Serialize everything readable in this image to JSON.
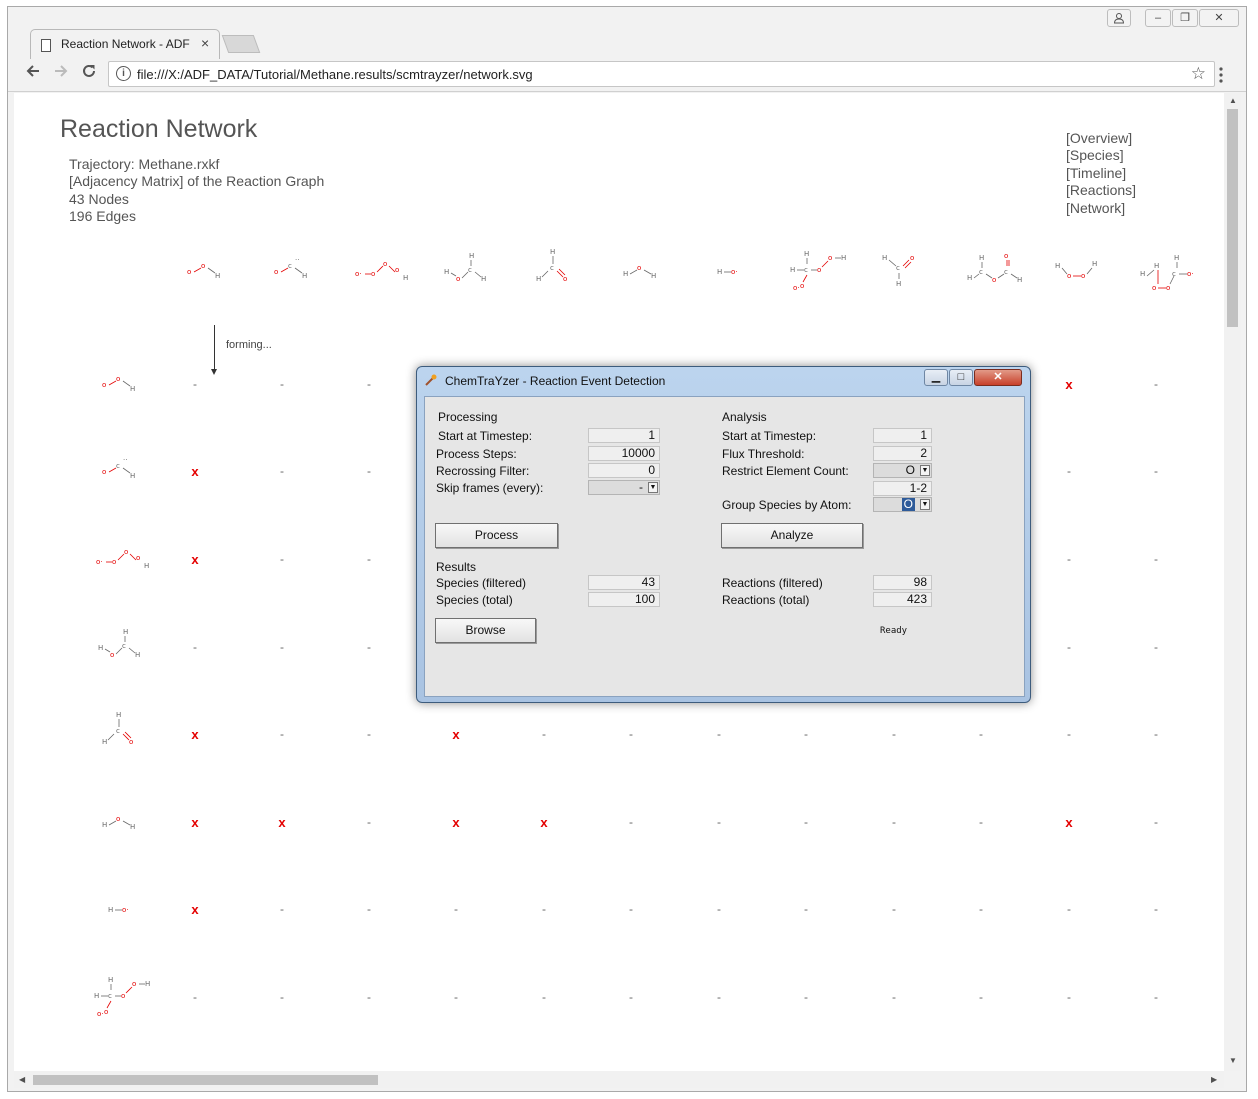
{
  "browser": {
    "tab_title": "Reaction Network - ADF",
    "tab_close": "×",
    "url": "file:///X:/ADF_DATA/Tutorial/Methane.results/scmtrayzer/network.svg",
    "window_buttons": [
      "‒",
      "❐",
      "✕"
    ]
  },
  "page": {
    "title": "Reaction Network",
    "info": [
      "Trajectory: Methane.rxkf",
      "[Adjacency Matrix] of the Reaction Graph",
      "43 Nodes",
      "196 Edges"
    ],
    "nav": [
      "[Overview]",
      "[Species]",
      "[Timeline]",
      "[Reactions]",
      "[Network]"
    ],
    "forming_label": "forming..."
  },
  "matrix": {
    "column_species": [
      "O-O-H radical",
      "O-C-H carbene",
      "O-O-O-H",
      "H-O-CH2 radical",
      "H-C=O",
      "H-O-H",
      "H-O radical",
      "H-C-O-O-H peroxide",
      "H-C=O-H",
      "H-C-O-C=O-H",
      "H-O-O-H",
      "H-C-O-O-C radical"
    ],
    "row_species": [
      "O-O-H radical",
      "O-C-H carbene",
      "O-O-O-H",
      "H-O-CH2 radical",
      "H-C=O",
      "H-O-H",
      "H-O radical",
      "H-C-O-O-H peroxide"
    ],
    "rows": [
      [
        "-",
        "-",
        "-",
        "",
        "",
        "",
        "",
        "",
        "",
        "",
        "x",
        "-"
      ],
      [
        "x",
        "-",
        "-",
        "",
        "",
        "",
        "",
        "",
        "",
        "",
        "-",
        "-"
      ],
      [
        "x",
        "-",
        "-",
        "",
        "",
        "",
        "",
        "",
        "",
        "",
        "-",
        "-"
      ],
      [
        "-",
        "-",
        "-",
        "",
        "",
        "",
        "",
        "",
        "",
        "",
        "-",
        "-"
      ],
      [
        "x",
        "-",
        "-",
        "x",
        "-",
        "-",
        "-",
        "-",
        "-",
        "-",
        "-",
        "-"
      ],
      [
        "x",
        "x",
        "-",
        "x",
        "x",
        "-",
        "-",
        "-",
        "-",
        "-",
        "x",
        "-"
      ],
      [
        "x",
        "-",
        "-",
        "-",
        "-",
        "-",
        "-",
        "-",
        "-",
        "-",
        "-",
        "-"
      ],
      [
        "-",
        "-",
        "-",
        "-",
        "-",
        "-",
        "-",
        "-",
        "-",
        "-",
        "-",
        "-"
      ]
    ]
  },
  "dialog": {
    "title": "ChemTraYzer - Reaction Event Detection",
    "processing": {
      "heading": "Processing",
      "start_label": "Start at Timestep:",
      "start_value": "1",
      "steps_label": "Process Steps:",
      "steps_value": "10000",
      "recross_label": "Recrossing Filter:",
      "recross_value": "0",
      "skip_label": "Skip frames (every):",
      "skip_value": "-",
      "button": "Process"
    },
    "analysis": {
      "heading": "Analysis",
      "start_label": "Start at Timestep:",
      "start_value": "1",
      "flux_label": "Flux Threshold:",
      "flux_value": "2",
      "restrict_label": "Restrict Element Count:",
      "restrict_value": "O",
      "range_value": "1-2",
      "group_label": "Group Species by Atom:",
      "group_value": "O",
      "button": "Analyze"
    },
    "results": {
      "heading": "Results",
      "species_filtered_label": "Species (filtered)",
      "species_filtered_value": "43",
      "species_total_label": "Species (total)",
      "species_total_value": "100",
      "reactions_filtered_label": "Reactions (filtered)",
      "reactions_filtered_value": "98",
      "reactions_total_label": "Reactions (total)",
      "reactions_total_value": "423",
      "browse_button": "Browse",
      "status": "Ready"
    }
  },
  "colors": {
    "reaction_mark": "#e40000",
    "oxygen": "#e40000",
    "hydrogen_carbon": "#666666",
    "dialog_frame": "#a9c3e2"
  }
}
